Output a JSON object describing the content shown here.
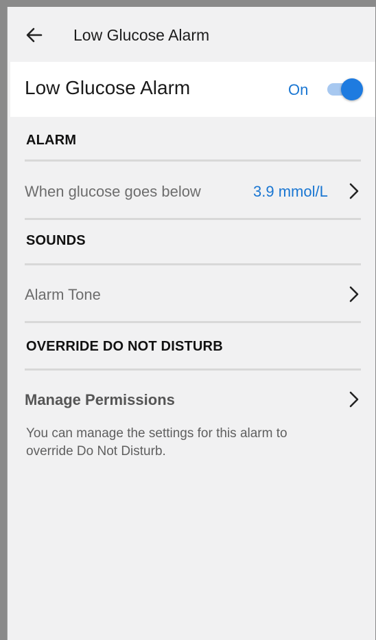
{
  "app_bar": {
    "title": "Low Glucose Alarm"
  },
  "toggle": {
    "title": "Low Glucose Alarm",
    "status": "On",
    "on": true
  },
  "sections": {
    "alarm": {
      "header": "ALARM",
      "row_label": "When glucose goes below",
      "row_value": "3.9 mmol/L"
    },
    "sounds": {
      "header": "SOUNDS",
      "row_label": "Alarm Tone"
    },
    "override": {
      "header": "OVERRIDE DO NOT DISTURB",
      "row_label": "Manage Permissions",
      "note": "You can manage the settings for this alarm to override Do Not Disturb."
    }
  },
  "colors": {
    "accent": "#1976d2",
    "switch_thumb": "#1e7be0",
    "switch_track": "#a7c8f0",
    "background": "#f1f1f2"
  },
  "icons": {
    "back": "arrow-left-icon",
    "chevron": "chevron-right-icon"
  }
}
